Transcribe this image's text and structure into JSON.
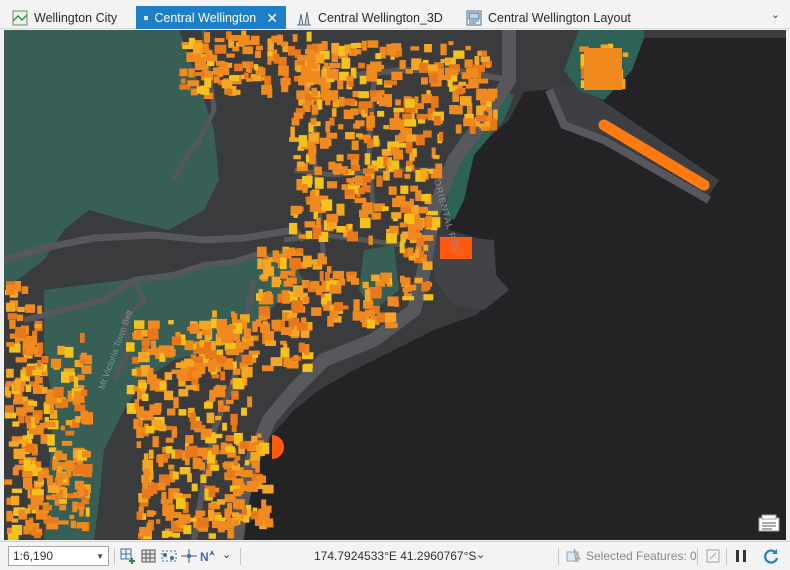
{
  "tabs": [
    {
      "label": "Wellington City",
      "icon": "map-view-icon"
    },
    {
      "label": "Central Wellington",
      "icon": "map-view-icon",
      "active": true
    },
    {
      "label": "Central Wellington_3D",
      "icon": "scene-view-icon"
    },
    {
      "label": "Central Wellington Layout",
      "icon": "layout-view-icon"
    }
  ],
  "map": {
    "road_labels": [
      "ORIENTAL PDE",
      "Mt Victoria Town Belt"
    ],
    "colors": {
      "water": "#232326",
      "land": "#3a3b3d",
      "park": "#385f56",
      "road": "#55575b",
      "buildings_orange": "#f08a1e",
      "buildings_yellow": "#f5c21c",
      "buildings_red": "#ff5a10"
    }
  },
  "statusbar": {
    "scale": "1:6,190",
    "coordinates": "174.7924533°E 41.2960767°S",
    "selected_features": "Selected Features: 0"
  }
}
